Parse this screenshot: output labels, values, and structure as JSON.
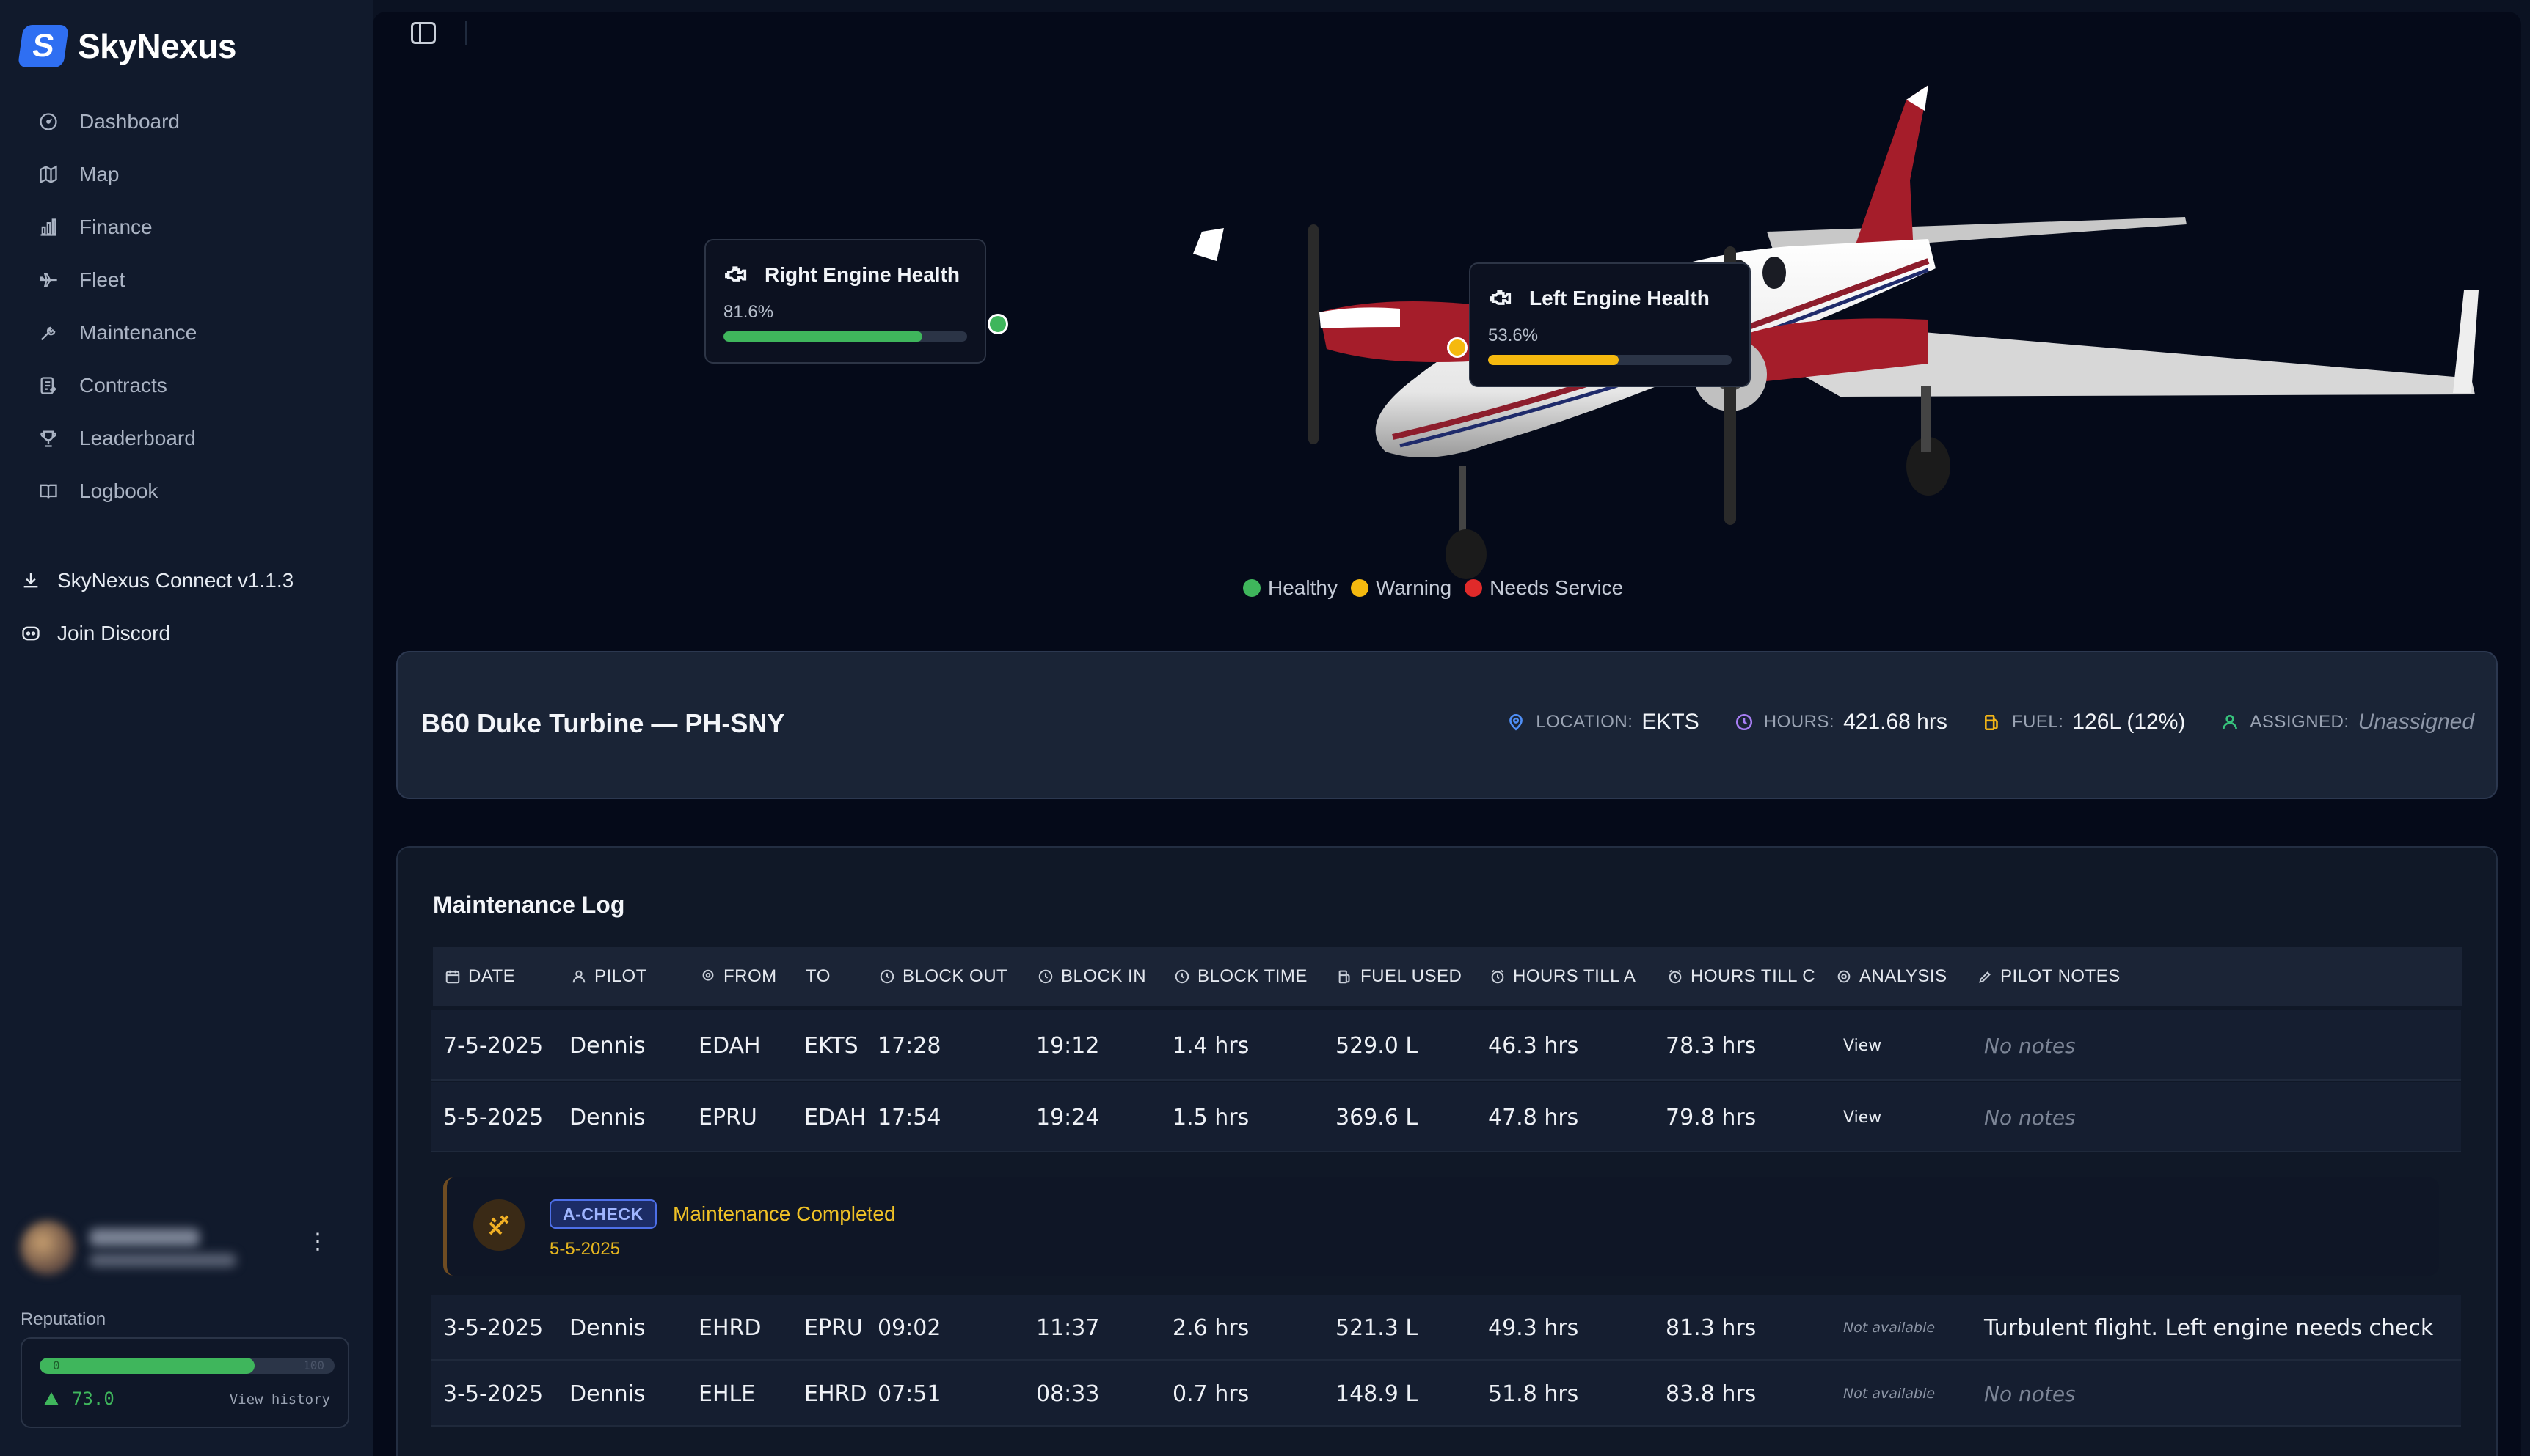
{
  "app": {
    "name": "SkyNexus",
    "logo_glyph": "S"
  },
  "sidebar": {
    "items": [
      {
        "label": "Dashboard",
        "icon": "dashboard-icon"
      },
      {
        "label": "Map",
        "icon": "map-icon"
      },
      {
        "label": "Finance",
        "icon": "finance-icon"
      },
      {
        "label": "Fleet",
        "icon": "fleet-icon"
      },
      {
        "label": "Maintenance",
        "icon": "wrench-icon"
      },
      {
        "label": "Contracts",
        "icon": "contracts-icon"
      },
      {
        "label": "Leaderboard",
        "icon": "trophy-icon"
      },
      {
        "label": "Logbook",
        "icon": "book-icon"
      }
    ],
    "external": [
      {
        "label": "SkyNexus Connect v1.1.3",
        "icon": "download-icon"
      },
      {
        "label": "Join Discord",
        "icon": "discord-icon"
      }
    ],
    "reputation": {
      "label": "Reputation",
      "value": "73.0",
      "min": "0",
      "max": "100",
      "fraction": 0.73,
      "history_label": "View history"
    }
  },
  "engines": {
    "right": {
      "title": "Right Engine Health",
      "percent": "81.6%",
      "fraction": 0.816,
      "color": "#3fb65c"
    },
    "left": {
      "title": "Left Engine Health",
      "percent": "53.6%",
      "fraction": 0.536,
      "color": "#f5b90f"
    }
  },
  "legend": [
    {
      "label": "Healthy",
      "color": "#3fb65c"
    },
    {
      "label": "Warning",
      "color": "#f5b90f"
    },
    {
      "label": "Needs Service",
      "color": "#e02a2a"
    }
  ],
  "aircraft": {
    "title": "B60 Duke Turbine — PH-SNY",
    "location_label": "LOCATION:",
    "location": "EKTS",
    "hours_label": "HOURS:",
    "hours": "421.68 hrs",
    "fuel_label": "FUEL:",
    "fuel": "126L (12%)",
    "assigned_label": "ASSIGNED:",
    "assigned": "Unassigned"
  },
  "log": {
    "title": "Maintenance Log",
    "columns": [
      "DATE",
      "PILOT",
      "FROM",
      "TO",
      "BLOCK OUT",
      "BLOCK IN",
      "BLOCK TIME",
      "FUEL USED",
      "HOURS TILL A",
      "HOURS TILL C",
      "ANALYSIS",
      "PILOT NOTES"
    ],
    "rows": [
      {
        "date": "7-5-2025",
        "pilot": "Dennis",
        "from": "EDAH",
        "to": "EKTS",
        "out": "17:28",
        "in": "19:12",
        "time": "1.4 hrs",
        "fuel": "529.0 L",
        "till_a": "46.3 hrs",
        "till_c": "78.3 hrs",
        "analysis": "View",
        "notes": "No notes"
      },
      {
        "date": "5-5-2025",
        "pilot": "Dennis",
        "from": "EPRU",
        "to": "EDAH",
        "out": "17:54",
        "in": "19:24",
        "time": "1.5 hrs",
        "fuel": "369.6 L",
        "till_a": "47.8 hrs",
        "till_c": "79.8 hrs",
        "analysis": "View",
        "notes": "No notes"
      },
      {
        "date": "3-5-2025",
        "pilot": "Dennis",
        "from": "EHRD",
        "to": "EPRU",
        "out": "09:02",
        "in": "11:37",
        "time": "2.6 hrs",
        "fuel": "521.3 L",
        "till_a": "49.3 hrs",
        "till_c": "81.3 hrs",
        "analysis": "Not available",
        "notes": "Turbulent flight. Left engine needs check"
      },
      {
        "date": "3-5-2025",
        "pilot": "Dennis",
        "from": "EHLE",
        "to": "EHRD",
        "out": "07:51",
        "in": "08:33",
        "time": "0.7 hrs",
        "fuel": "148.9 L",
        "till_a": "51.8 hrs",
        "till_c": "83.8 hrs",
        "analysis": "Not available",
        "notes": "No notes"
      }
    ],
    "event": {
      "badge": "A-CHECK",
      "title": "Maintenance Completed",
      "date": "5-5-2025"
    }
  }
}
